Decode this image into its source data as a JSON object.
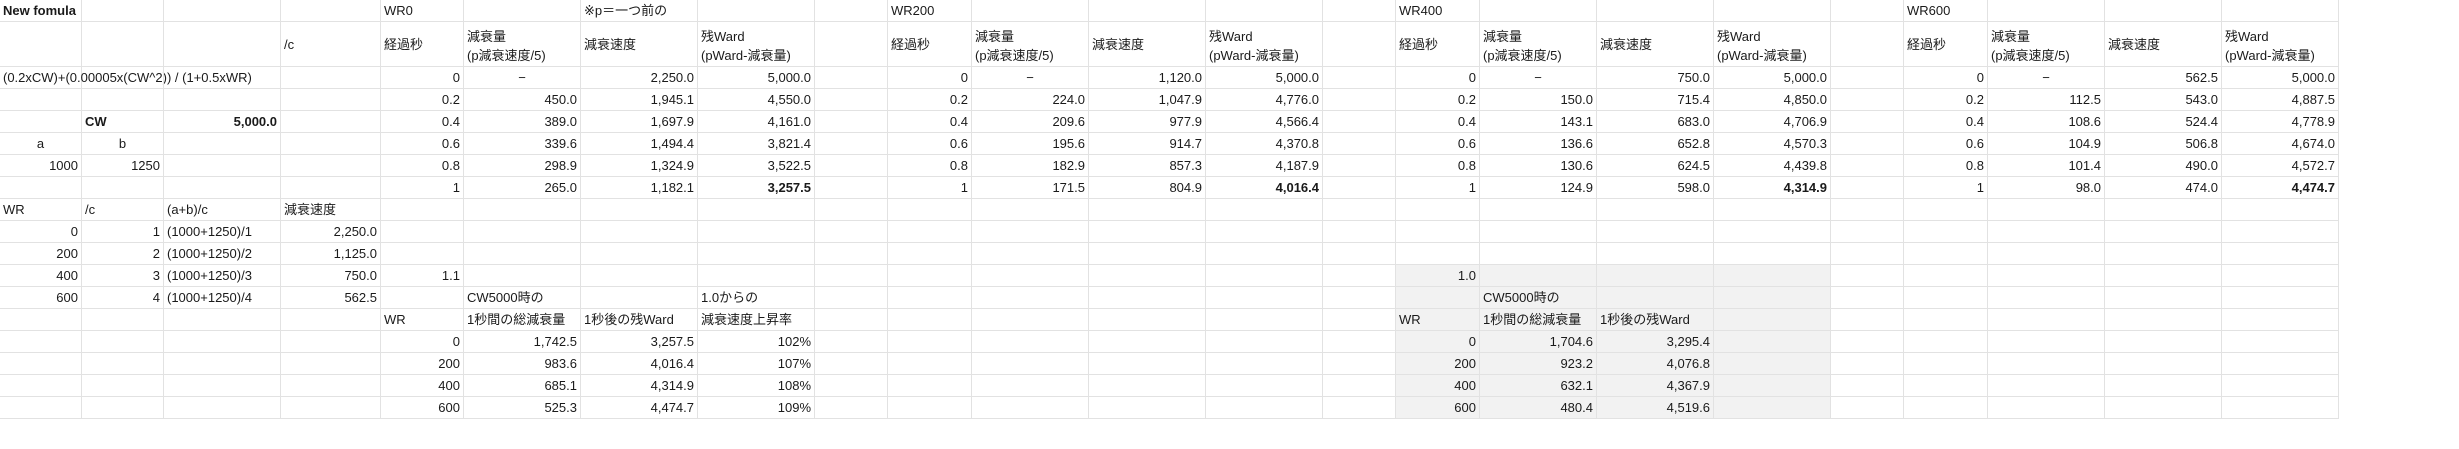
{
  "sheet": {
    "rows": [
      [
        [
          "New fomula",
          "l",
          1
        ],
        null,
        null,
        null,
        [
          "WR0",
          "l"
        ],
        null,
        [
          "※p＝一つ前の",
          "l"
        ],
        null,
        null,
        [
          "WR200",
          "l"
        ],
        null,
        null,
        null,
        null,
        [
          "WR400",
          "l"
        ],
        null,
        null,
        null,
        null,
        [
          "WR600",
          "l"
        ],
        null,
        null,
        null
      ],
      [
        null,
        null,
        null,
        [
          "/c",
          "l"
        ],
        [
          "経過秒",
          "l"
        ],
        [
          "減衰量\n(p減衰速度/5)",
          "l"
        ],
        [
          "減衰速度",
          "l"
        ],
        [
          "残Ward\n(pWard-減衰量)",
          "l"
        ],
        null,
        [
          "経過秒",
          "l"
        ],
        [
          "減衰量\n(p減衰速度/5)",
          "l"
        ],
        [
          "減衰速度",
          "l"
        ],
        [
          "残Ward\n(pWard-減衰量)",
          "l"
        ],
        null,
        [
          "経過秒",
          "l"
        ],
        [
          "減衰量\n(p減衰速度/5)",
          "l"
        ],
        [
          "減衰速度",
          "l"
        ],
        [
          "残Ward\n(pWard-減衰量)",
          "l"
        ],
        null,
        [
          "経過秒",
          "l"
        ],
        [
          "減衰量\n(p減衰速度/5)",
          "l"
        ],
        [
          "減衰速度",
          "l"
        ],
        [
          "残Ward\n(pWard-減衰量)",
          "l"
        ]
      ],
      [
        [
          "(0.2xCW)+(0.00005x(CW^2)) / (1+0.5xWR)",
          "l"
        ],
        null,
        null,
        null,
        [
          "0",
          "r"
        ],
        [
          "−",
          "c"
        ],
        [
          "2,250.0",
          "r"
        ],
        [
          "5,000.0",
          "r"
        ],
        null,
        [
          "0",
          "r"
        ],
        [
          "−",
          "c"
        ],
        [
          "1,120.0",
          "r"
        ],
        [
          "5,000.0",
          "r"
        ],
        null,
        [
          "0",
          "r"
        ],
        [
          "−",
          "c"
        ],
        [
          "750.0",
          "r"
        ],
        [
          "5,000.0",
          "r"
        ],
        null,
        [
          "0",
          "r"
        ],
        [
          "−",
          "c"
        ],
        [
          "562.5",
          "r"
        ],
        [
          "5,000.0",
          "r"
        ]
      ],
      [
        null,
        null,
        null,
        null,
        [
          "0.2",
          "r"
        ],
        [
          "450.0",
          "r"
        ],
        [
          "1,945.1",
          "r"
        ],
        [
          "4,550.0",
          "r"
        ],
        null,
        [
          "0.2",
          "r"
        ],
        [
          "224.0",
          "r"
        ],
        [
          "1,047.9",
          "r"
        ],
        [
          "4,776.0",
          "r"
        ],
        null,
        [
          "0.2",
          "r"
        ],
        [
          "150.0",
          "r"
        ],
        [
          "715.4",
          "r"
        ],
        [
          "4,850.0",
          "r"
        ],
        null,
        [
          "0.2",
          "r"
        ],
        [
          "112.5",
          "r"
        ],
        [
          "543.0",
          "r"
        ],
        [
          "4,887.5",
          "r"
        ]
      ],
      [
        null,
        [
          "CW",
          "l",
          1
        ],
        [
          "5,000.0",
          "r",
          1
        ],
        null,
        [
          "0.4",
          "r"
        ],
        [
          "389.0",
          "r"
        ],
        [
          "1,697.9",
          "r"
        ],
        [
          "4,161.0",
          "r"
        ],
        null,
        [
          "0.4",
          "r"
        ],
        [
          "209.6",
          "r"
        ],
        [
          "977.9",
          "r"
        ],
        [
          "4,566.4",
          "r"
        ],
        null,
        [
          "0.4",
          "r"
        ],
        [
          "143.1",
          "r"
        ],
        [
          "683.0",
          "r"
        ],
        [
          "4,706.9",
          "r"
        ],
        null,
        [
          "0.4",
          "r"
        ],
        [
          "108.6",
          "r"
        ],
        [
          "524.4",
          "r"
        ],
        [
          "4,778.9",
          "r"
        ]
      ],
      [
        [
          "a",
          "c"
        ],
        [
          "b",
          "c"
        ],
        null,
        null,
        [
          "0.6",
          "r"
        ],
        [
          "339.6",
          "r"
        ],
        [
          "1,494.4",
          "r"
        ],
        [
          "3,821.4",
          "r"
        ],
        null,
        [
          "0.6",
          "r"
        ],
        [
          "195.6",
          "r"
        ],
        [
          "914.7",
          "r"
        ],
        [
          "4,370.8",
          "r"
        ],
        null,
        [
          "0.6",
          "r"
        ],
        [
          "136.6",
          "r"
        ],
        [
          "652.8",
          "r"
        ],
        [
          "4,570.3",
          "r"
        ],
        null,
        [
          "0.6",
          "r"
        ],
        [
          "104.9",
          "r"
        ],
        [
          "506.8",
          "r"
        ],
        [
          "4,674.0",
          "r"
        ]
      ],
      [
        [
          "1000",
          "r"
        ],
        [
          "1250",
          "r"
        ],
        null,
        null,
        [
          "0.8",
          "r"
        ],
        [
          "298.9",
          "r"
        ],
        [
          "1,324.9",
          "r"
        ],
        [
          "3,522.5",
          "r"
        ],
        null,
        [
          "0.8",
          "r"
        ],
        [
          "182.9",
          "r"
        ],
        [
          "857.3",
          "r"
        ],
        [
          "4,187.9",
          "r"
        ],
        null,
        [
          "0.8",
          "r"
        ],
        [
          "130.6",
          "r"
        ],
        [
          "624.5",
          "r"
        ],
        [
          "4,439.8",
          "r"
        ],
        null,
        [
          "0.8",
          "r"
        ],
        [
          "101.4",
          "r"
        ],
        [
          "490.0",
          "r"
        ],
        [
          "4,572.7",
          "r"
        ]
      ],
      [
        null,
        null,
        null,
        null,
        [
          "1",
          "r"
        ],
        [
          "265.0",
          "r"
        ],
        [
          "1,182.1",
          "r"
        ],
        [
          "3,257.5",
          "r",
          1
        ],
        null,
        [
          "1",
          "r"
        ],
        [
          "171.5",
          "r"
        ],
        [
          "804.9",
          "r"
        ],
        [
          "4,016.4",
          "r",
          1
        ],
        null,
        [
          "1",
          "r"
        ],
        [
          "124.9",
          "r"
        ],
        [
          "598.0",
          "r"
        ],
        [
          "4,314.9",
          "r",
          1
        ],
        null,
        [
          "1",
          "r"
        ],
        [
          "98.0",
          "r"
        ],
        [
          "474.0",
          "r"
        ],
        [
          "4,474.7",
          "r",
          1
        ]
      ],
      [
        [
          "WR",
          "l"
        ],
        [
          "/c",
          "l"
        ],
        [
          "(a+b)/c",
          "l"
        ],
        [
          "減衰速度",
          "l"
        ],
        null,
        null,
        null,
        null,
        null,
        null,
        null,
        null,
        null,
        null,
        null,
        null,
        null,
        null,
        null,
        null,
        null,
        null,
        null
      ],
      [
        [
          "0",
          "r"
        ],
        [
          "1",
          "r"
        ],
        [
          "(1000+1250)/1",
          "l"
        ],
        [
          "2,250.0",
          "r"
        ],
        null,
        null,
        null,
        null,
        null,
        null,
        null,
        null,
        null,
        null,
        null,
        null,
        null,
        null,
        null,
        null,
        null,
        null,
        null
      ],
      [
        [
          "200",
          "r"
        ],
        [
          "2",
          "r"
        ],
        [
          "(1000+1250)/2",
          "l"
        ],
        [
          "1,125.0",
          "r"
        ],
        null,
        null,
        null,
        null,
        null,
        null,
        null,
        null,
        null,
        null,
        null,
        null,
        null,
        null,
        null,
        null,
        null,
        null,
        null
      ],
      [
        [
          "400",
          "r"
        ],
        [
          "3",
          "r"
        ],
        [
          "(1000+1250)/3",
          "l"
        ],
        [
          "750.0",
          "r"
        ],
        [
          "1.1",
          "r"
        ],
        null,
        null,
        null,
        null,
        null,
        null,
        null,
        null,
        null,
        [
          "1.0",
          "r"
        ],
        null,
        null,
        null,
        null,
        null,
        null,
        null,
        null
      ],
      [
        [
          "600",
          "r"
        ],
        [
          "4",
          "r"
        ],
        [
          "(1000+1250)/4",
          "l"
        ],
        [
          "562.5",
          "r"
        ],
        null,
        [
          "CW5000時の",
          "l"
        ],
        null,
        [
          "1.0からの",
          "l"
        ],
        null,
        null,
        null,
        null,
        null,
        null,
        null,
        [
          "CW5000時の",
          "l"
        ],
        null,
        null,
        null,
        null,
        null,
        null,
        null
      ],
      [
        null,
        null,
        null,
        null,
        [
          "WR",
          "l"
        ],
        [
          "1秒間の総減衰量",
          "l"
        ],
        [
          "1秒後の残Ward",
          "l"
        ],
        [
          "減衰速度上昇率",
          "l"
        ],
        null,
        null,
        null,
        null,
        null,
        null,
        [
          "WR",
          "l"
        ],
        [
          "1秒間の総減衰量",
          "l"
        ],
        [
          "1秒後の残Ward",
          "l"
        ],
        null,
        null,
        null,
        null,
        null,
        null
      ],
      [
        null,
        null,
        null,
        null,
        [
          "0",
          "r"
        ],
        [
          "1,742.5",
          "r"
        ],
        [
          "3,257.5",
          "r"
        ],
        [
          "102%",
          "r"
        ],
        null,
        null,
        null,
        null,
        null,
        null,
        [
          "0",
          "r"
        ],
        [
          "1,704.6",
          "r"
        ],
        [
          "3,295.4",
          "r"
        ],
        null,
        null,
        null,
        null,
        null,
        null
      ],
      [
        null,
        null,
        null,
        null,
        [
          "200",
          "r"
        ],
        [
          "983.6",
          "r"
        ],
        [
          "4,016.4",
          "r"
        ],
        [
          "107%",
          "r"
        ],
        null,
        null,
        null,
        null,
        null,
        null,
        [
          "200",
          "r"
        ],
        [
          "923.2",
          "r"
        ],
        [
          "4,076.8",
          "r"
        ],
        null,
        null,
        null,
        null,
        null,
        null
      ],
      [
        null,
        null,
        null,
        null,
        [
          "400",
          "r"
        ],
        [
          "685.1",
          "r"
        ],
        [
          "4,314.9",
          "r"
        ],
        [
          "108%",
          "r"
        ],
        null,
        null,
        null,
        null,
        null,
        null,
        [
          "400",
          "r"
        ],
        [
          "632.1",
          "r"
        ],
        [
          "4,367.9",
          "r"
        ],
        null,
        null,
        null,
        null,
        null,
        null
      ],
      [
        null,
        null,
        null,
        null,
        [
          "600",
          "r"
        ],
        [
          "525.3",
          "r"
        ],
        [
          "4,474.7",
          "r"
        ],
        [
          "109%",
          "r"
        ],
        null,
        null,
        null,
        null,
        null,
        null,
        [
          "600",
          "r"
        ],
        [
          "480.4",
          "r"
        ],
        [
          "4,519.6",
          "r"
        ],
        null,
        null,
        null,
        null,
        null,
        null
      ]
    ],
    "colors": {
      "grid": "#e2e2e2",
      "shade": "#f2f2f2",
      "text": "#1a1a1a"
    }
  }
}
